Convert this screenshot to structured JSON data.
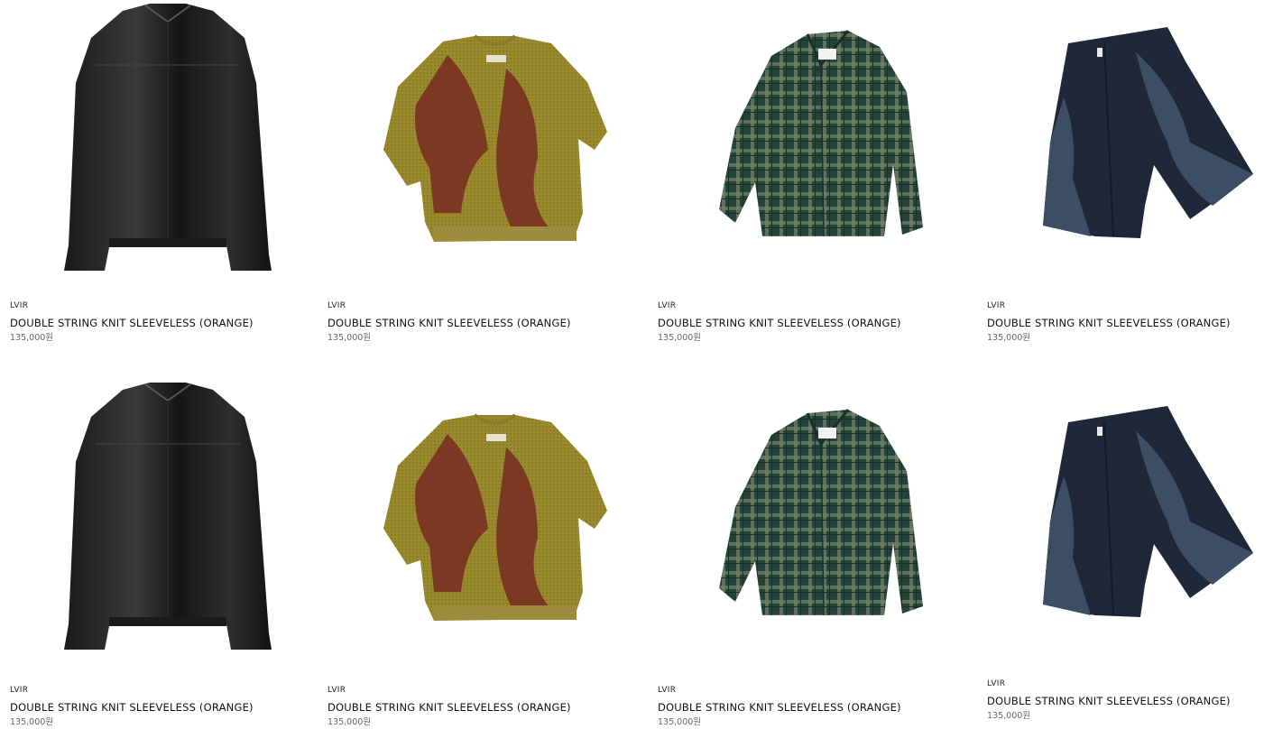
{
  "products": [
    {
      "brand": "LVIR",
      "name": "DOUBLE STRING KNIT SLEEVELESS (ORANGE)",
      "price": "135,000원",
      "image": "black-leather-jacket"
    },
    {
      "brand": "LVIR",
      "name": "DOUBLE STRING KNIT SLEEVELESS (ORANGE)",
      "price": "135,000원",
      "image": "olive-brown-knit-top"
    },
    {
      "brand": "LVIR",
      "name": "DOUBLE STRING KNIT SLEEVELESS (ORANGE)",
      "price": "135,000원",
      "image": "green-check-shirt"
    },
    {
      "brand": "LVIR",
      "name": "DOUBLE STRING KNIT SLEEVELESS (ORANGE)",
      "price": "135,000원",
      "image": "navy-panel-shorts"
    },
    {
      "brand": "LVIR",
      "name": "DOUBLE STRING KNIT SLEEVELESS (ORANGE)",
      "price": "135,000원",
      "image": "black-leather-jacket"
    },
    {
      "brand": "LVIR",
      "name": "DOUBLE STRING KNIT SLEEVELESS (ORANGE)",
      "price": "135,000원",
      "image": "olive-brown-knit-top"
    },
    {
      "brand": "LVIR",
      "name": "DOUBLE STRING KNIT SLEEVELESS (ORANGE)",
      "price": "135,000원",
      "image": "green-check-shirt"
    },
    {
      "brand": "LVIR",
      "name": "DOUBLE STRING KNIT SLEEVELESS (ORANGE)",
      "price": "135,000원",
      "image": "navy-panel-shorts"
    }
  ]
}
